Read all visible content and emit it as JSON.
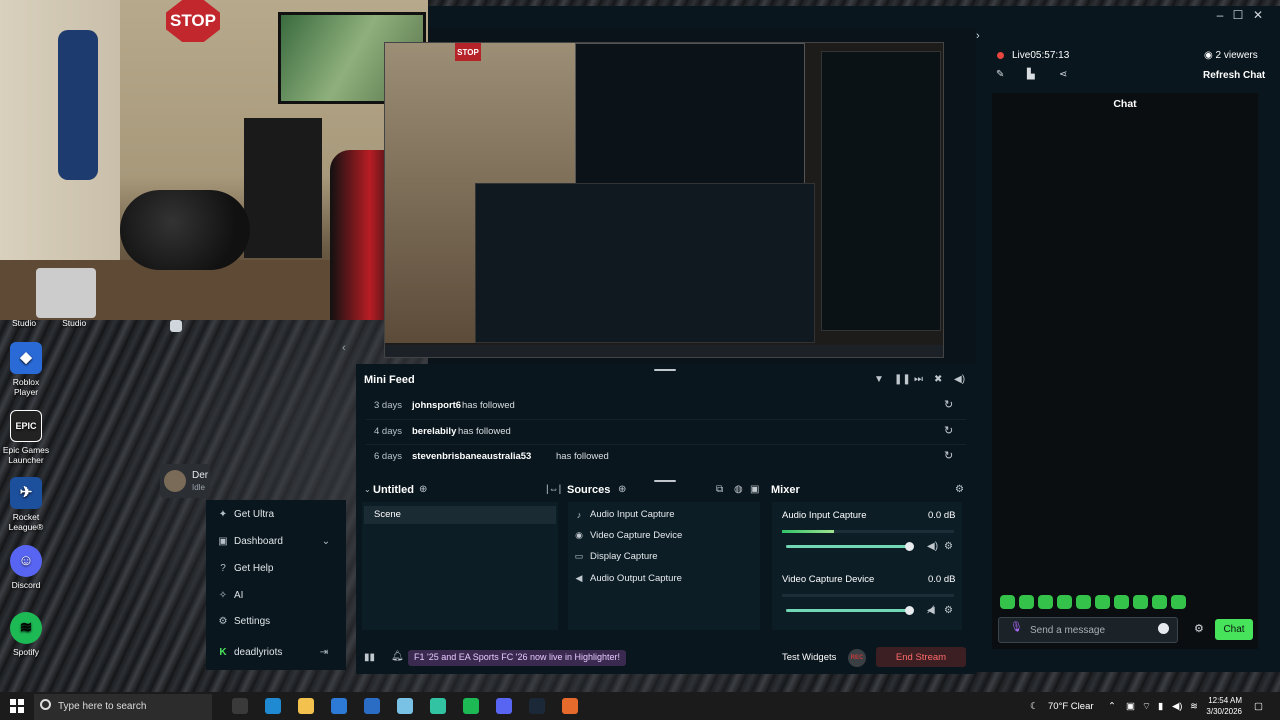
{
  "desktop": {
    "top_labels": [
      "Studio",
      "Studio"
    ],
    "icons": [
      {
        "label": "Roblox Player",
        "icon": "roblox-icon",
        "color": "#2a6ad7"
      },
      {
        "label": "Epic Games Launcher",
        "icon": "epic-games-icon",
        "color": "#222222",
        "glyph": "EPIC"
      },
      {
        "label": "Rocket League®",
        "icon": "rocket-league-icon",
        "color": "#1c4f9c"
      },
      {
        "label": "Discord",
        "icon": "discord-icon",
        "color": "#5865f2"
      },
      {
        "label": "Spotify",
        "icon": "spotify-icon",
        "color": "#1db954"
      }
    ]
  },
  "webcam": {
    "sign_text": "STOP"
  },
  "preview": {
    "sign_text": "STOP"
  },
  "user_chip": {
    "name": "Der",
    "status": "Idle"
  },
  "nav": {
    "items": [
      {
        "label": "Get Ultra",
        "icon": "ultra-icon"
      },
      {
        "label": "Dashboard",
        "icon": "dashboard-icon"
      },
      {
        "label": "Get Help",
        "icon": "help-icon"
      },
      {
        "label": "AI",
        "icon": "ai-icon"
      },
      {
        "label": "Settings",
        "icon": "gear-icon"
      }
    ],
    "username": "deadlyriots"
  },
  "mini_feed": {
    "title": "Mini Feed",
    "rows": [
      {
        "days": "3 days",
        "user": "johnsport6",
        "action": "has followed"
      },
      {
        "days": "4 days",
        "user": "berelabily",
        "action": "has followed"
      },
      {
        "days": "6 days",
        "user": "stevenbrisbaneaustralia53",
        "action": "has followed"
      }
    ]
  },
  "scenes": {
    "title": "Untitled",
    "items": [
      "Scene"
    ]
  },
  "sources": {
    "title": "Sources",
    "items": [
      {
        "label": "Audio Input Capture",
        "icon": "microphone-icon"
      },
      {
        "label": "Video Capture Device",
        "icon": "camera-icon"
      },
      {
        "label": "Display Capture",
        "icon": "monitor-icon"
      },
      {
        "label": "Audio Output Capture",
        "icon": "speaker-icon"
      }
    ]
  },
  "mixer": {
    "title": "Mixer",
    "channels": [
      {
        "label": "Audio Input Capture",
        "db": "0.0 dB",
        "level": 0.3,
        "volume": 1.0
      },
      {
        "label": "Video Capture Device",
        "db": "0.0 dB",
        "level": 0.0,
        "volume": 1.0
      }
    ]
  },
  "bottom": {
    "highlighter_banner": "F1 '25 and EA Sports FC '26 now live in Highlighter!",
    "test_widgets": "Test Widgets",
    "rec": "REC",
    "end_stream": "End Stream"
  },
  "chat_panel": {
    "live_label": "Live",
    "live_time": "05:57:13",
    "viewers": "2 viewers",
    "refresh": "Refresh Chat",
    "chat_title": "Chat",
    "input_placeholder": "Send a message",
    "chat_button": "Chat",
    "emote_count": 10
  },
  "taskbar": {
    "search_placeholder": "Type here to search",
    "weather": "70°F  Clear",
    "time": "12:54 AM",
    "date": "3/30/2026",
    "apps": [
      {
        "icon": "task-view-icon",
        "color": "#3a3a3a"
      },
      {
        "icon": "edge-icon",
        "color": "#1f8ad2"
      },
      {
        "icon": "file-explorer-icon",
        "color": "#f2c14e"
      },
      {
        "icon": "store-icon",
        "color": "#2d7ad6"
      },
      {
        "icon": "mail-icon",
        "color": "#2b6cc4"
      },
      {
        "icon": "photos-icon",
        "color": "#7ac1e6"
      },
      {
        "icon": "streamlabs-icon",
        "color": "#31c3a2"
      },
      {
        "icon": "spotify-icon",
        "color": "#1db954"
      },
      {
        "icon": "discord-icon",
        "color": "#5865f2"
      },
      {
        "icon": "steam-icon",
        "color": "#1b2838"
      },
      {
        "icon": "firefox-icon",
        "color": "#e66a2c"
      }
    ]
  },
  "colors": {
    "accent": "#47e35b",
    "live": "#e9453f",
    "end_stream": "#ff6b6b",
    "panel_bg": "#09161d"
  }
}
